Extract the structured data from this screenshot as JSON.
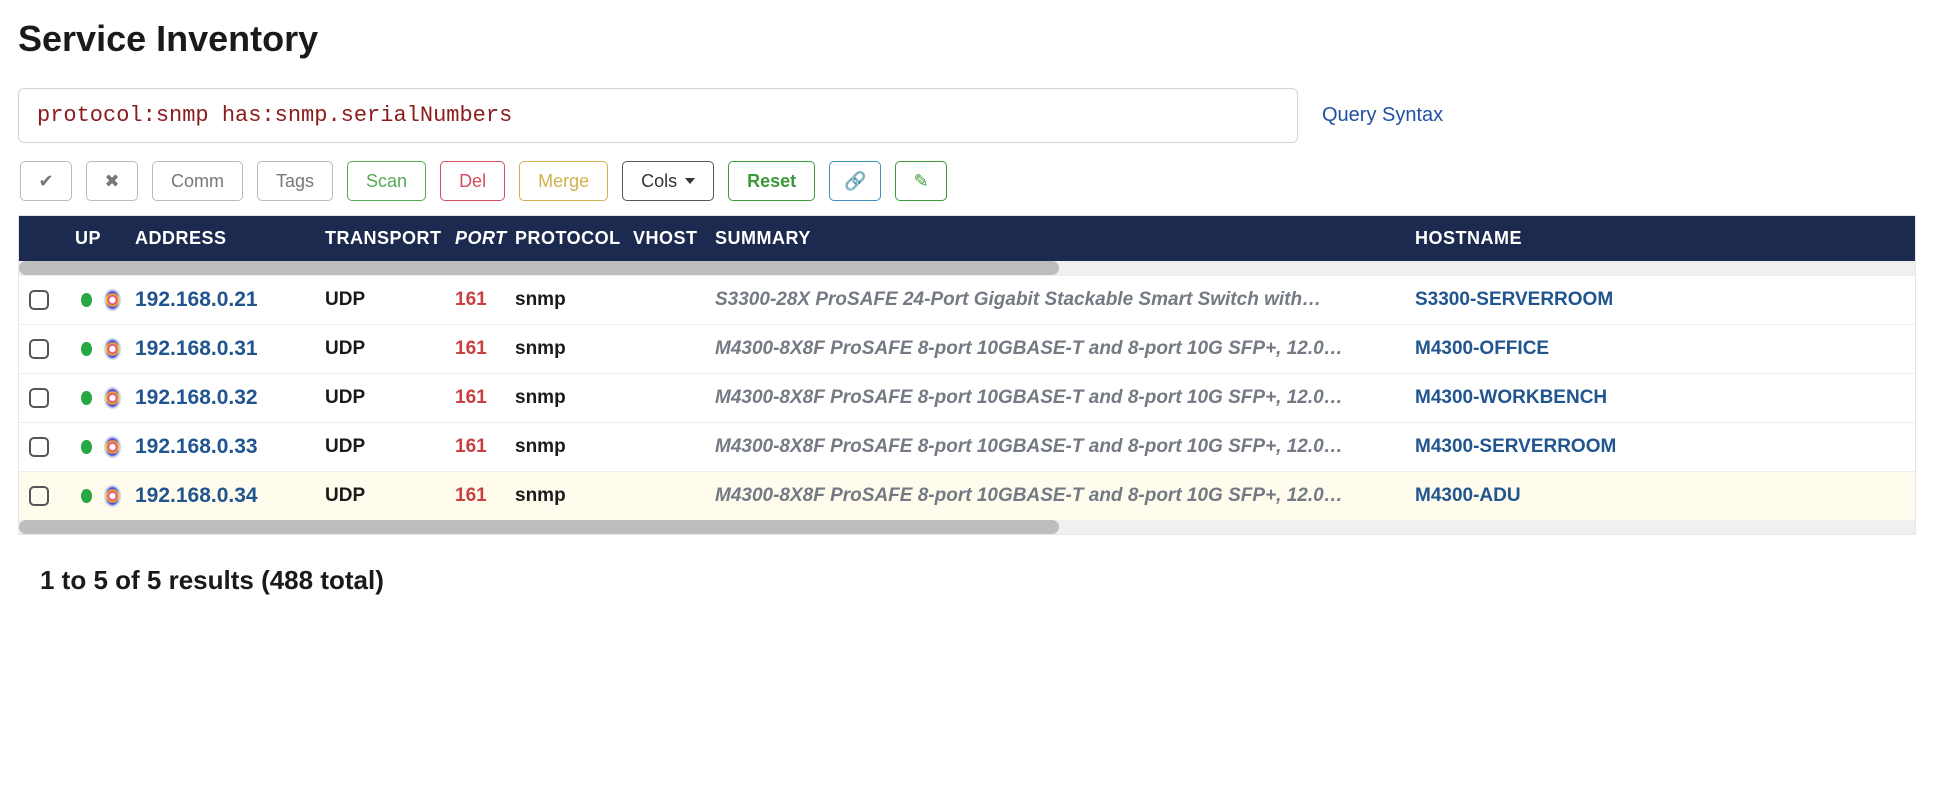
{
  "page": {
    "title": "Service Inventory",
    "query": "protocol:snmp has:snmp.serialNumbers",
    "query_syntax_label": "Query Syntax",
    "results_summary": "1 to 5 of 5 results (488 total)"
  },
  "toolbar": {
    "check_icon": "✔",
    "x_icon": "✖",
    "comm": "Comm",
    "tags": "Tags",
    "scan": "Scan",
    "del": "Del",
    "merge": "Merge",
    "cols": "Cols",
    "reset": "Reset",
    "link_icon": "🔗",
    "note_icon": "✎"
  },
  "columns": {
    "up": "UP",
    "address": "ADDRESS",
    "transport": "TRANSPORT",
    "port": "PORT",
    "protocol": "PROTOCOL",
    "vhost": "VHOST",
    "summary": "SUMMARY",
    "hostname": "HOSTNAME"
  },
  "rows": [
    {
      "address": "192.168.0.21",
      "transport": "UDP",
      "port": "161",
      "protocol": "snmp",
      "vhost": "",
      "summary": "S3300-28X ProSAFE 24-Port Gigabit Stackable Smart Switch with…",
      "hostname": "S3300-SERVERROOM"
    },
    {
      "address": "192.168.0.31",
      "transport": "UDP",
      "port": "161",
      "protocol": "snmp",
      "vhost": "",
      "summary": "M4300-8X8F ProSAFE 8-port 10GBASE-T and 8-port 10G SFP+, 12.0…",
      "hostname": "M4300-OFFICE"
    },
    {
      "address": "192.168.0.32",
      "transport": "UDP",
      "port": "161",
      "protocol": "snmp",
      "vhost": "",
      "summary": "M4300-8X8F ProSAFE 8-port 10GBASE-T and 8-port 10G SFP+, 12.0…",
      "hostname": "M4300-WORKBENCH"
    },
    {
      "address": "192.168.0.33",
      "transport": "UDP",
      "port": "161",
      "protocol": "snmp",
      "vhost": "",
      "summary": "M4300-8X8F ProSAFE 8-port 10GBASE-T and 8-port 10G SFP+, 12.0…",
      "hostname": "M4300-SERVERROOM"
    },
    {
      "address": "192.168.0.34",
      "transport": "UDP",
      "port": "161",
      "protocol": "snmp",
      "vhost": "",
      "summary": "M4300-8X8F ProSAFE 8-port 10GBASE-T and 8-port 10G SFP+, 12.0…",
      "hostname": "M4300-ADU"
    }
  ]
}
